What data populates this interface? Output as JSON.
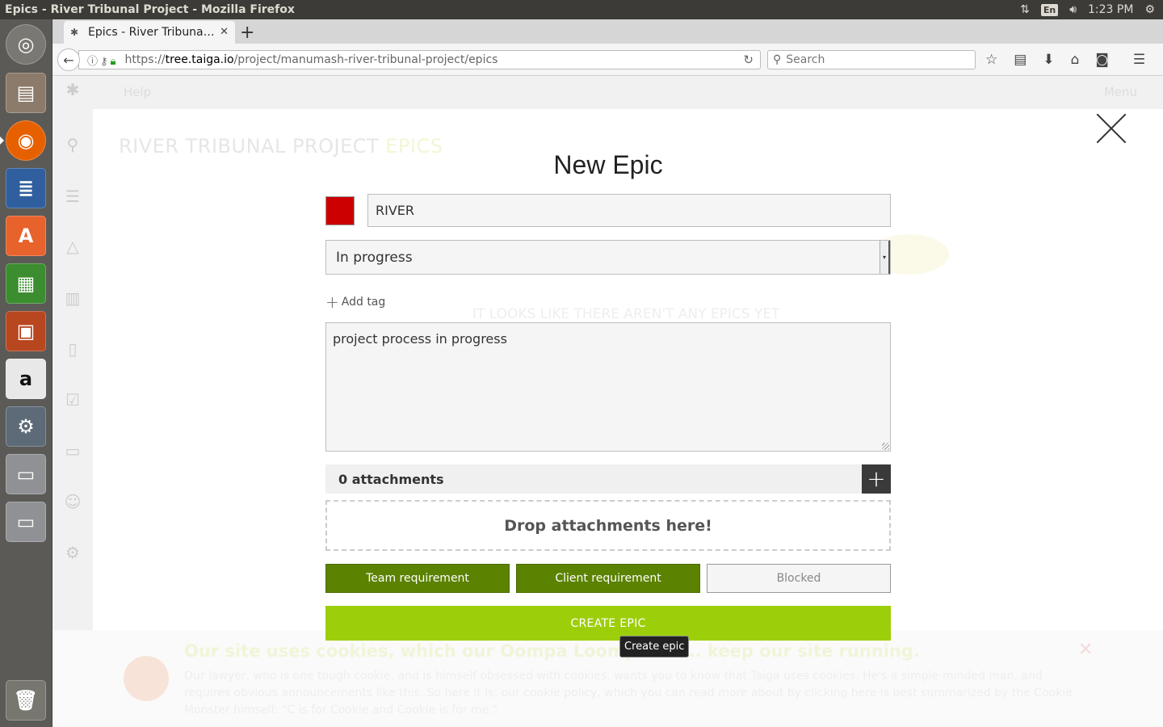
{
  "os": {
    "window_title": "Epics - River Tribunal Project - Mozilla Firefox",
    "time": "1:23 PM",
    "keyboard_layout": "En"
  },
  "launcher": {
    "items": [
      "ubuntu-dash",
      "files",
      "firefox",
      "libreoffice-writer",
      "software-center",
      "libreoffice-calc",
      "libreoffice-impress",
      "amazon",
      "system-settings",
      "drive",
      "drive",
      "trash"
    ]
  },
  "browser": {
    "tab_title": "Epics - River Tribuna…",
    "url_host": "tree.taiga.io",
    "url_scheme": "https://",
    "url_path": "/project/manumash-river-tribunal-project/epics",
    "search_placeholder": "Search"
  },
  "background_page": {
    "help": "Help",
    "menu": "Menu",
    "project_title": "RIVER TRIBUNAL PROJECT",
    "section_title": "EPICS",
    "empty_message": "IT LOOKS LIKE THERE AREN'T ANY EPICS YET"
  },
  "modal": {
    "title": "New Epic",
    "color": "#cc0000",
    "subject": "RIVER",
    "status": "In progress",
    "add_tag_label": "Add tag",
    "description": "project process in progress",
    "attachments_label": "0 attachments",
    "drop_label": "Drop attachments here!",
    "toggles": {
      "team_requirement": "Team requirement",
      "client_requirement": "Client requirement",
      "blocked": "Blocked"
    },
    "create_button": "CREATE EPIC",
    "create_tooltip": "Create epic"
  },
  "cookie_banner": {
    "title": "Our site uses cookies, which our Oompa Loompas m... keep our site running.",
    "body": "Our lawyer, who is one tough cookie, and is himself obsessed with cookies, wants you to know that Taiga uses cookies. He's a simple-minded man, and requires obvious announcements like this. So here it is: our cookie policy, which you can read more about by clicking here is best summarized by the Cookie Monster himself: \"C is for Cookie and Cookie is for me.\""
  },
  "colors": {
    "accent_green": "#9dce0a",
    "toggle_on": "#5b8200",
    "ubuntu_bar": "#3c3b37"
  }
}
